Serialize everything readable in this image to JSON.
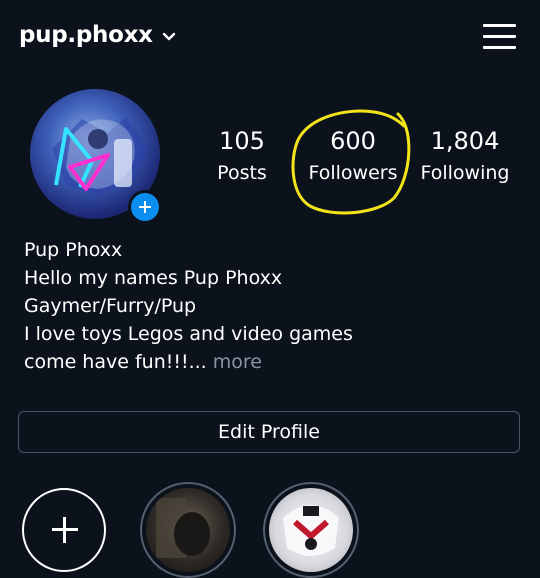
{
  "header": {
    "username": "pup.phoxx"
  },
  "stats": {
    "posts": {
      "count": "105",
      "label": "Posts"
    },
    "followers": {
      "count": "600",
      "label": "Followers"
    },
    "following": {
      "count": "1,804",
      "label": "Following"
    }
  },
  "bio": {
    "name": "Pup Phoxx",
    "lines": [
      "Hello my names Pup Phoxx",
      "Gaymer/Furry/Pup",
      "I love toys Legos and video games",
      "come have fun!!!..."
    ],
    "more": "more"
  },
  "actions": {
    "edit_profile": "Edit Profile"
  },
  "colors": {
    "background": "#0c121c",
    "accent_blue": "#0b8ef0",
    "annotation_yellow": "#f2e419",
    "muted_text": "#8a93a3"
  },
  "icons": {
    "menu": "hamburger-menu-icon",
    "dropdown": "chevron-down-icon",
    "add": "plus-icon"
  }
}
